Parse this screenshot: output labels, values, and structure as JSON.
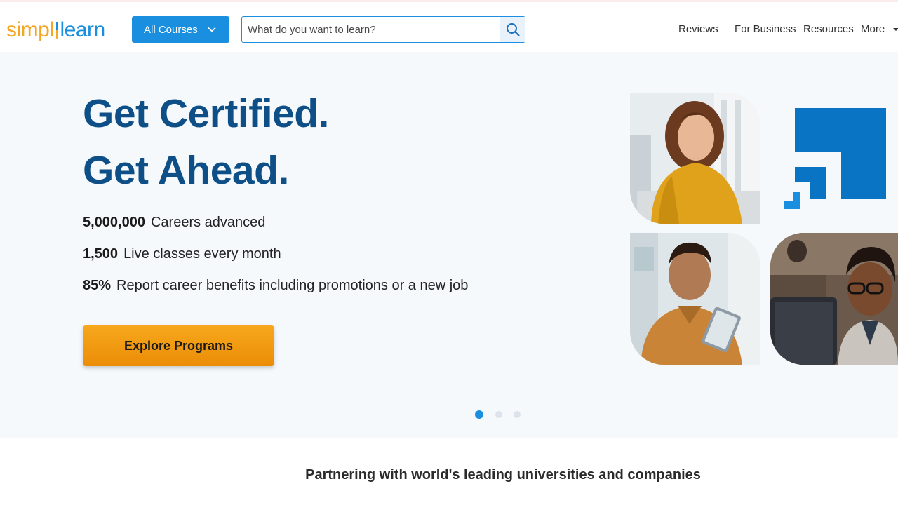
{
  "header": {
    "logo": {
      "part1": "simpl",
      "part2": "learn"
    },
    "all_courses_label": "All Courses",
    "search_placeholder": "What do you want to learn?",
    "nav": {
      "reviews": "Reviews",
      "for_business": "For Business",
      "resources": "Resources",
      "more": "More"
    }
  },
  "hero": {
    "headline_line1": "Get Certified.",
    "headline_line2": "Get Ahead.",
    "stats": [
      {
        "value": "5,000,000",
        "label": "Careers advanced"
      },
      {
        "value": "1,500",
        "label": "Live classes every month"
      },
      {
        "value": "85%",
        "label": "Report career benefits including promotions or a new job"
      }
    ],
    "cta_label": "Explore Programs",
    "carousel": {
      "total_slides": 3,
      "active_slide": 1
    }
  },
  "partner_heading": "Partnering with world's leading universities and companies",
  "colors": {
    "brand_blue": "#1a8fe0",
    "headline_blue": "#0d4f86",
    "cta_orange": "#f5a01a",
    "logo_orange": "#f5a623"
  },
  "icons": {
    "search": "search-icon",
    "chevron": "chevron-down-icon",
    "caret": "caret-down-icon"
  }
}
